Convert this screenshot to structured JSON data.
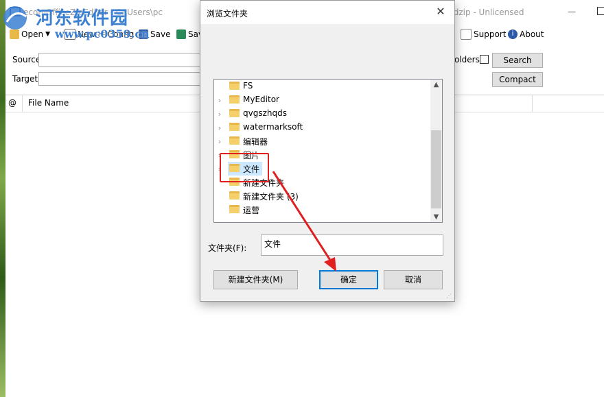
{
  "main_window": {
    "title_left": "ecomOfficeZipEditor  -  C:\\Users\\pc",
    "title_right": "rdzip  -  Unlicensed",
    "toolbar": {
      "open": "Open",
      "new": "New",
      "config": "Config",
      "save": "Save",
      "save_as": "Sav",
      "support": "Support",
      "about": "About"
    },
    "source_label": "Source",
    "target_label": "Target",
    "subfolders_label": "olders",
    "search_button": "Search",
    "compact_button": "Compact",
    "columns": [
      "@",
      "File Name"
    ]
  },
  "watermark": {
    "title": "河东软件园",
    "url": "www.pc0359.cn"
  },
  "dialog": {
    "title": "浏览文件夹",
    "close": "✕",
    "tree_items": [
      {
        "label": "FS",
        "expandable": false
      },
      {
        "label": "MyEditor",
        "expandable": true
      },
      {
        "label": "qvgszhqds",
        "expandable": true
      },
      {
        "label": "watermarksoft",
        "expandable": true
      },
      {
        "label": "编辑器",
        "expandable": true
      },
      {
        "label": "图片",
        "expandable": true
      },
      {
        "label": "文件",
        "expandable": true,
        "selected": true
      },
      {
        "label": "新建文件夹",
        "expandable": false
      },
      {
        "label": "新建文件夹 (3)",
        "expandable": false
      },
      {
        "label": "运营",
        "expandable": false
      }
    ],
    "folder_label": "文件夹(F):",
    "folder_value": "文件",
    "new_folder_button": "新建文件夹(M)",
    "ok_button": "确定",
    "cancel_button": "取消"
  },
  "colors": {
    "annotation": "#e02020",
    "selection": "#cce8ff",
    "primary_border": "#0078d7"
  }
}
